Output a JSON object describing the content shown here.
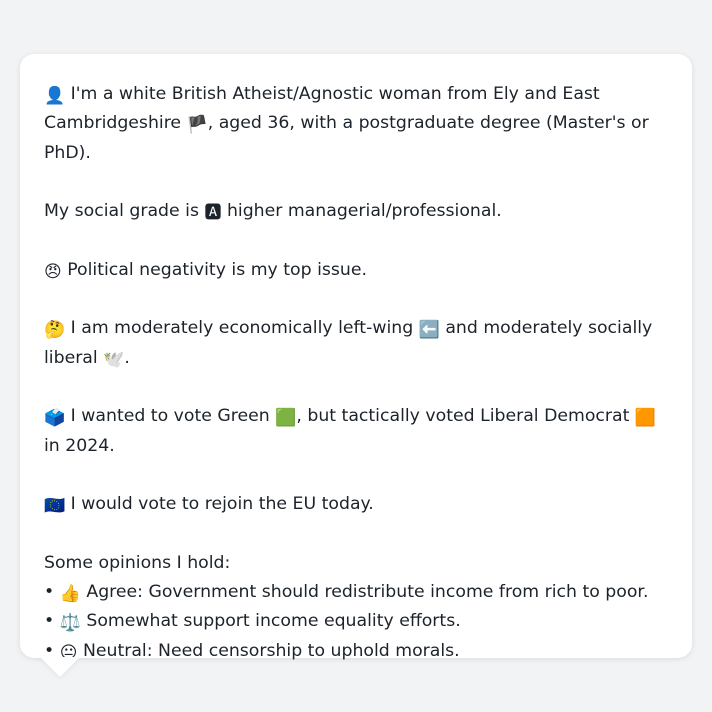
{
  "bio": {
    "intro_icon": "👤",
    "intro_text_1": "I'm a white British Atheist/Agnostic woman from Ely and East Cambridgeshire ",
    "intro_flag": "🏴",
    "intro_text_2": ", aged 36, with a postgraduate degree (Master's or PhD).",
    "social_text_1": "My social grade is ",
    "social_icon": "🅰",
    "social_text_2": " higher managerial/professional.",
    "issue_icon": "😠",
    "issue_text": "Political negativity is my top issue.",
    "ideology_icon": "🤔",
    "ideology_text_1": "I am moderately economically left-wing ",
    "ideology_left_icon": "⬅️",
    "ideology_text_2": " and moderately socially liberal ",
    "ideology_dove_icon": "🕊️",
    "ideology_text_3": ".",
    "vote_icon": "🗳️",
    "vote_text_1": "I wanted to vote Green ",
    "vote_green_icon": "🟩",
    "vote_text_2": ", but tactically voted Liberal Democrat ",
    "vote_libdem_icon": "🟧",
    "vote_text_3": " in 2024.",
    "eu_icon": "🇪🇺",
    "eu_text": "I would vote to rejoin the EU today.",
    "opinions_heading": "Some opinions I hold:",
    "opinions": [
      {
        "bullet": "•",
        "icon": "👍",
        "text": "Agree: Government should redistribute income from rich to poor."
      },
      {
        "bullet": "•",
        "icon": "⚖️",
        "text": "Somewhat support income equality efforts."
      },
      {
        "bullet": "•",
        "icon": "😐",
        "text": "Neutral: Need censorship to uphold morals."
      }
    ]
  },
  "colors": {
    "background": "#f1f3f5",
    "bubble": "#ffffff",
    "text": "#1c232b"
  }
}
